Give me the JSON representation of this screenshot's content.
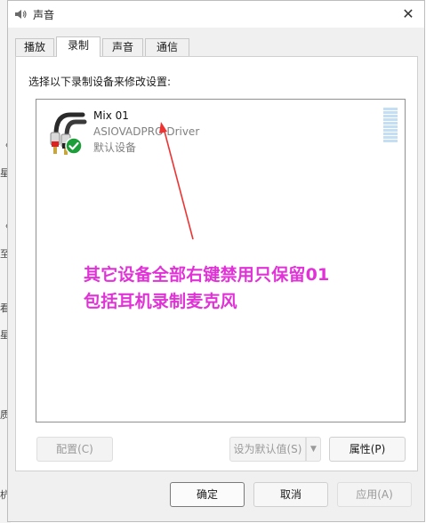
{
  "window": {
    "title": "声音"
  },
  "background_strip": [
    "〈",
    "星",
    "〈",
    "至",
    "看",
    "星",
    "质",
    "杭"
  ],
  "tabs": [
    {
      "label": "播放",
      "active": false
    },
    {
      "label": "录制",
      "active": true
    },
    {
      "label": "声音",
      "active": false
    },
    {
      "label": "通信",
      "active": false
    }
  ],
  "instruction": "选择以下录制设备来修改设置:",
  "device": {
    "name": "Mix 01",
    "driver": "ASIOVADPRO Driver",
    "status": "默认设备",
    "icon": "rca-cable-icon",
    "badge": "green-check-icon"
  },
  "annotation": {
    "line1": "其它设备全部右键禁用只保留01",
    "line2": "包括耳机录制麦克风",
    "color": "#e032d6"
  },
  "buttons": {
    "configure": "配置(C)",
    "set_default": "设为默认值(S)",
    "properties": "属性(P)",
    "ok": "确定",
    "cancel": "取消",
    "apply": "应用(A)"
  }
}
